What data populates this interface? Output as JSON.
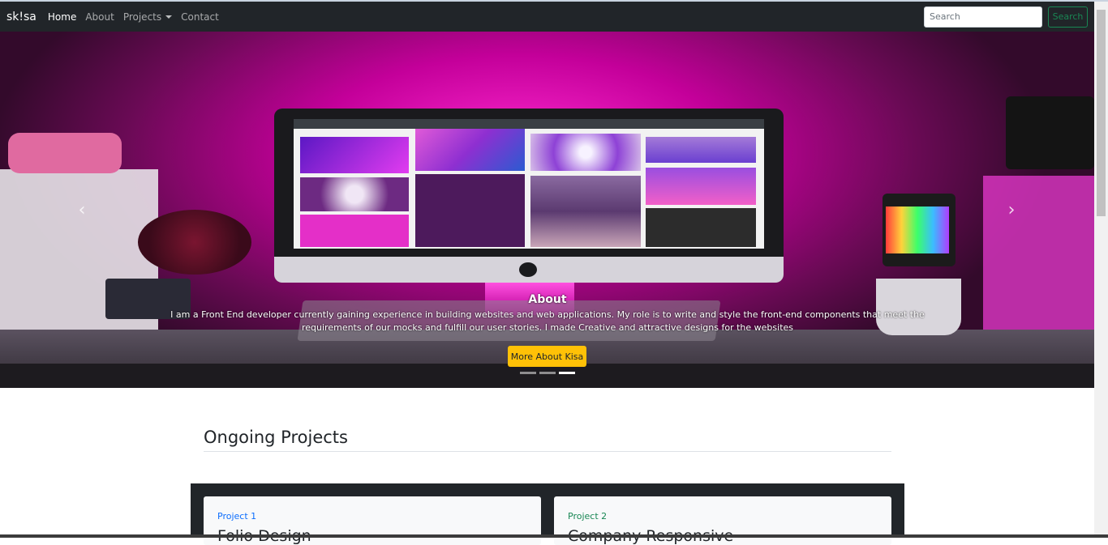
{
  "navbar": {
    "brand": "sk!sa",
    "links": [
      {
        "label": "Home",
        "active": true
      },
      {
        "label": "About",
        "active": false
      },
      {
        "label": "Projects",
        "active": false,
        "dropdown": true
      },
      {
        "label": "Contact",
        "active": false
      }
    ],
    "search": {
      "placeholder": "Search",
      "button_label": "Search"
    }
  },
  "carousel": {
    "caption_title": "About",
    "caption_text": "I am a Front End developer currently gaining experience in building websites and web applications. My role is to write and style the front-end components that meet the requirements of our mocks and fulfill our user stories. I made Creative and attractive designs for the websites",
    "button_label": "More About Kisa",
    "prev_icon": "‹",
    "next_icon": "›",
    "slide_count": 3,
    "active_slide": 3
  },
  "projects": {
    "heading": "Ongoing Projects",
    "cards": [
      {
        "label": "Project 1",
        "label_color": "#0d6efd",
        "title": "Folio Design"
      },
      {
        "label": "Project 2",
        "label_color": "#198754",
        "title": "Company Responsive"
      }
    ]
  },
  "colors": {
    "navbar_bg": "#212529",
    "accent_yellow": "#ffc107",
    "success_green": "#198754",
    "primary_blue": "#0d6efd"
  }
}
